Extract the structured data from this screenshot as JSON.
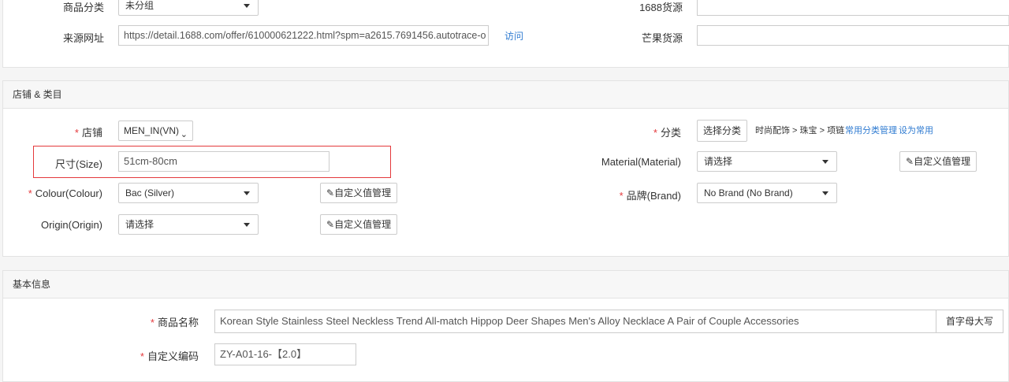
{
  "source_panel": {
    "category_label": "商品分类",
    "category_value": "未分组",
    "url_label": "来源网址",
    "url_value": "https://detail.1688.com/offer/610000621222.html?spm=a2615.7691456.autotrace-o",
    "visit_link": "访问",
    "src1688_label": "1688货源",
    "src1688_value": "",
    "mango_label": "芒果货源",
    "mango_value": ""
  },
  "store_panel": {
    "title": "店铺 & 类目",
    "required_mark": "*",
    "store_label": "店铺",
    "store_value": "MEN_IN(VN)",
    "size_label": "尺寸(Size)",
    "size_value": "51cm-80cm",
    "colour_label": "Colour(Colour)",
    "colour_value": "Bac (Silver)",
    "origin_label": "Origin(Origin)",
    "origin_value": "请选择",
    "custom_value_btn": "自定义值管理",
    "category_label": "分类",
    "choose_category_btn": "选择分类",
    "category_path": "时尚配饰 > 珠宝 > 项链",
    "common_category_link": "常用分类管理",
    "set_common_link": "设为常用",
    "material_label": "Material(Material)",
    "material_value": "请选择",
    "brand_label": "品牌(Brand)",
    "brand_value": "No Brand (No Brand)"
  },
  "basic_panel": {
    "title": "基本信息",
    "required_mark": "*",
    "name_label": "商品名称",
    "name_value": "Korean Style Stainless Steel Neckless Trend All-match Hippop Deer Shapes Men's Alloy Necklace A Pair of Couple Accessories",
    "capitalize_btn": "首字母大写",
    "code_label": "自定义编码",
    "code_value": "ZY-A01-16-【2.0】"
  },
  "colors": {
    "required": "#e4393c",
    "link": "#2f7bd1",
    "highlight_border": "#e4393c"
  },
  "icons": {
    "edit": "edit-icon",
    "dropdown": "caret-down-icon"
  }
}
